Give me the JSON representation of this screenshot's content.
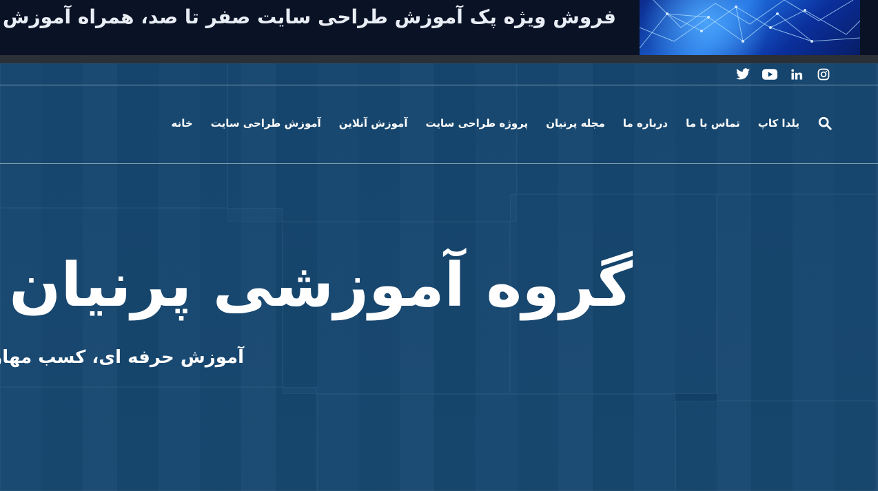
{
  "banner": {
    "text": "فروش ویژه پک آموزش طراحی سایت صفر تا صد، همراه آموزش"
  },
  "social": [
    {
      "name": "instagram-icon"
    },
    {
      "name": "linkedin-icon"
    },
    {
      "name": "youtube-icon"
    },
    {
      "name": "twitter-icon"
    }
  ],
  "nav": {
    "items": [
      "خانه",
      "آموزش طراحی سایت",
      "آموزش آنلاین",
      "پروژه طراحی سایت",
      "مجله پرنیان",
      "درباره ما",
      "تماس با ما",
      "یلدا کاپ"
    ]
  },
  "hero": {
    "title": "گروه آموزشی پرنیان",
    "subtitle": "آموزش حرفه ای، کسب مهارت"
  },
  "colors": {
    "banner_bg": "#0a1226",
    "hero_overlay": "#0a3e69",
    "text": "#ffffff"
  }
}
